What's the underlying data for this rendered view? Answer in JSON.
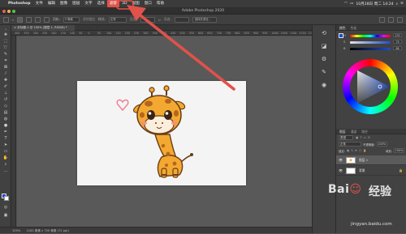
{
  "menubar": {
    "apple_icon": "apple-logo-icon",
    "app_name": "Photoshop",
    "items": [
      "文件",
      "编辑",
      "图像",
      "图层",
      "文字",
      "选择",
      "滤镜",
      "3D",
      "视图",
      "窗口",
      "帮助"
    ],
    "highlighted_item": "滤镜",
    "clock": "10月28日 周二 14:24",
    "highlight_color": "#e0524a"
  },
  "window": {
    "title": "Adobe Photoshop 2020"
  },
  "optionsbar": {
    "feather_label": "羽化:",
    "feather_value": "0 像素",
    "antialias_label": "消除锯齿",
    "style_label": "样式:",
    "style_value": "正常",
    "width_label": "宽度:",
    "height_label": "高度:",
    "select_mask_label": "选择并遮住..."
  },
  "document_tab": {
    "label": "未标题-1 @ 100% (图层 1, RGB/8) *",
    "close_icon": "close-icon"
  },
  "ruler": {
    "ticks": [
      "400",
      "350",
      "300",
      "250",
      "200",
      "150",
      "100",
      "50",
      "0",
      "50",
      "100",
      "150",
      "200",
      "250",
      "300",
      "350",
      "400",
      "450",
      "500",
      "550",
      "600",
      "650",
      "700",
      "750",
      "800",
      "850",
      "900",
      "950",
      "1000",
      "1050",
      "1100",
      "1150",
      "1200"
    ]
  },
  "statusbar": {
    "zoom": "100%",
    "doc_info": "1200 像素 x 750 像素 (72 ppi)"
  },
  "color_panel": {
    "tabs": [
      "颜色",
      "色板"
    ],
    "sliders": [
      {
        "label": "H",
        "value": "233"
      },
      {
        "label": "S",
        "value": "79"
      },
      {
        "label": "B",
        "value": "88"
      }
    ]
  },
  "layers_panel": {
    "tabs": [
      "图层",
      "通道",
      "路径"
    ],
    "filter_label": "类型",
    "blend_mode": "正常",
    "opacity_label": "不透明度:",
    "opacity_value": "100%",
    "lock_label": "锁定:",
    "fill_label": "填充:",
    "fill_value": "100%",
    "layers": [
      {
        "name": "图层 1",
        "selected": true
      },
      {
        "name": "背景",
        "selected": false
      }
    ]
  },
  "watermark": {
    "brand": "Baidu",
    "text": "经验",
    "url": "jingyan.baidu.com"
  },
  "annotation": {
    "arrow_color": "#e0524a"
  }
}
